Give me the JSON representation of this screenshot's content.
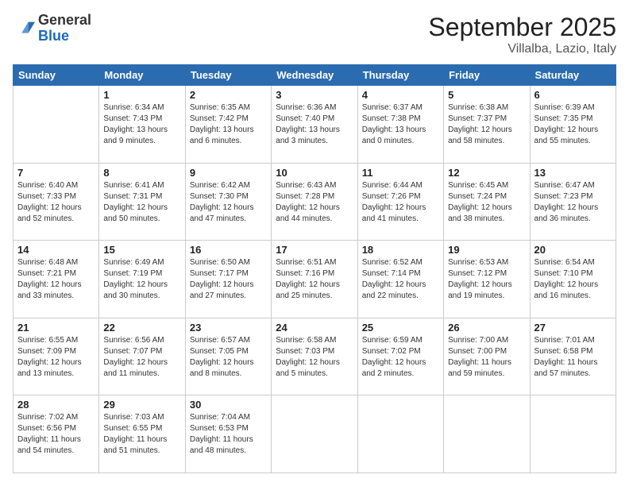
{
  "logo": {
    "general": "General",
    "blue": "Blue"
  },
  "header": {
    "month": "September 2025",
    "location": "Villalba, Lazio, Italy"
  },
  "days_of_week": [
    "Sunday",
    "Monday",
    "Tuesday",
    "Wednesday",
    "Thursday",
    "Friday",
    "Saturday"
  ],
  "weeks": [
    [
      {
        "day": "",
        "sunrise": "",
        "sunset": "",
        "daylight": ""
      },
      {
        "day": "1",
        "sunrise": "Sunrise: 6:34 AM",
        "sunset": "Sunset: 7:43 PM",
        "daylight": "Daylight: 13 hours and 9 minutes."
      },
      {
        "day": "2",
        "sunrise": "Sunrise: 6:35 AM",
        "sunset": "Sunset: 7:42 PM",
        "daylight": "Daylight: 13 hours and 6 minutes."
      },
      {
        "day": "3",
        "sunrise": "Sunrise: 6:36 AM",
        "sunset": "Sunset: 7:40 PM",
        "daylight": "Daylight: 13 hours and 3 minutes."
      },
      {
        "day": "4",
        "sunrise": "Sunrise: 6:37 AM",
        "sunset": "Sunset: 7:38 PM",
        "daylight": "Daylight: 13 hours and 0 minutes."
      },
      {
        "day": "5",
        "sunrise": "Sunrise: 6:38 AM",
        "sunset": "Sunset: 7:37 PM",
        "daylight": "Daylight: 12 hours and 58 minutes."
      },
      {
        "day": "6",
        "sunrise": "Sunrise: 6:39 AM",
        "sunset": "Sunset: 7:35 PM",
        "daylight": "Daylight: 12 hours and 55 minutes."
      }
    ],
    [
      {
        "day": "7",
        "sunrise": "Sunrise: 6:40 AM",
        "sunset": "Sunset: 7:33 PM",
        "daylight": "Daylight: 12 hours and 52 minutes."
      },
      {
        "day": "8",
        "sunrise": "Sunrise: 6:41 AM",
        "sunset": "Sunset: 7:31 PM",
        "daylight": "Daylight: 12 hours and 50 minutes."
      },
      {
        "day": "9",
        "sunrise": "Sunrise: 6:42 AM",
        "sunset": "Sunset: 7:30 PM",
        "daylight": "Daylight: 12 hours and 47 minutes."
      },
      {
        "day": "10",
        "sunrise": "Sunrise: 6:43 AM",
        "sunset": "Sunset: 7:28 PM",
        "daylight": "Daylight: 12 hours and 44 minutes."
      },
      {
        "day": "11",
        "sunrise": "Sunrise: 6:44 AM",
        "sunset": "Sunset: 7:26 PM",
        "daylight": "Daylight: 12 hours and 41 minutes."
      },
      {
        "day": "12",
        "sunrise": "Sunrise: 6:45 AM",
        "sunset": "Sunset: 7:24 PM",
        "daylight": "Daylight: 12 hours and 38 minutes."
      },
      {
        "day": "13",
        "sunrise": "Sunrise: 6:47 AM",
        "sunset": "Sunset: 7:23 PM",
        "daylight": "Daylight: 12 hours and 36 minutes."
      }
    ],
    [
      {
        "day": "14",
        "sunrise": "Sunrise: 6:48 AM",
        "sunset": "Sunset: 7:21 PM",
        "daylight": "Daylight: 12 hours and 33 minutes."
      },
      {
        "day": "15",
        "sunrise": "Sunrise: 6:49 AM",
        "sunset": "Sunset: 7:19 PM",
        "daylight": "Daylight: 12 hours and 30 minutes."
      },
      {
        "day": "16",
        "sunrise": "Sunrise: 6:50 AM",
        "sunset": "Sunset: 7:17 PM",
        "daylight": "Daylight: 12 hours and 27 minutes."
      },
      {
        "day": "17",
        "sunrise": "Sunrise: 6:51 AM",
        "sunset": "Sunset: 7:16 PM",
        "daylight": "Daylight: 12 hours and 25 minutes."
      },
      {
        "day": "18",
        "sunrise": "Sunrise: 6:52 AM",
        "sunset": "Sunset: 7:14 PM",
        "daylight": "Daylight: 12 hours and 22 minutes."
      },
      {
        "day": "19",
        "sunrise": "Sunrise: 6:53 AM",
        "sunset": "Sunset: 7:12 PM",
        "daylight": "Daylight: 12 hours and 19 minutes."
      },
      {
        "day": "20",
        "sunrise": "Sunrise: 6:54 AM",
        "sunset": "Sunset: 7:10 PM",
        "daylight": "Daylight: 12 hours and 16 minutes."
      }
    ],
    [
      {
        "day": "21",
        "sunrise": "Sunrise: 6:55 AM",
        "sunset": "Sunset: 7:09 PM",
        "daylight": "Daylight: 12 hours and 13 minutes."
      },
      {
        "day": "22",
        "sunrise": "Sunrise: 6:56 AM",
        "sunset": "Sunset: 7:07 PM",
        "daylight": "Daylight: 12 hours and 11 minutes."
      },
      {
        "day": "23",
        "sunrise": "Sunrise: 6:57 AM",
        "sunset": "Sunset: 7:05 PM",
        "daylight": "Daylight: 12 hours and 8 minutes."
      },
      {
        "day": "24",
        "sunrise": "Sunrise: 6:58 AM",
        "sunset": "Sunset: 7:03 PM",
        "daylight": "Daylight: 12 hours and 5 minutes."
      },
      {
        "day": "25",
        "sunrise": "Sunrise: 6:59 AM",
        "sunset": "Sunset: 7:02 PM",
        "daylight": "Daylight: 12 hours and 2 minutes."
      },
      {
        "day": "26",
        "sunrise": "Sunrise: 7:00 AM",
        "sunset": "Sunset: 7:00 PM",
        "daylight": "Daylight: 11 hours and 59 minutes."
      },
      {
        "day": "27",
        "sunrise": "Sunrise: 7:01 AM",
        "sunset": "Sunset: 6:58 PM",
        "daylight": "Daylight: 11 hours and 57 minutes."
      }
    ],
    [
      {
        "day": "28",
        "sunrise": "Sunrise: 7:02 AM",
        "sunset": "Sunset: 6:56 PM",
        "daylight": "Daylight: 11 hours and 54 minutes."
      },
      {
        "day": "29",
        "sunrise": "Sunrise: 7:03 AM",
        "sunset": "Sunset: 6:55 PM",
        "daylight": "Daylight: 11 hours and 51 minutes."
      },
      {
        "day": "30",
        "sunrise": "Sunrise: 7:04 AM",
        "sunset": "Sunset: 6:53 PM",
        "daylight": "Daylight: 11 hours and 48 minutes."
      },
      {
        "day": "",
        "sunrise": "",
        "sunset": "",
        "daylight": ""
      },
      {
        "day": "",
        "sunrise": "",
        "sunset": "",
        "daylight": ""
      },
      {
        "day": "",
        "sunrise": "",
        "sunset": "",
        "daylight": ""
      },
      {
        "day": "",
        "sunrise": "",
        "sunset": "",
        "daylight": ""
      }
    ]
  ]
}
